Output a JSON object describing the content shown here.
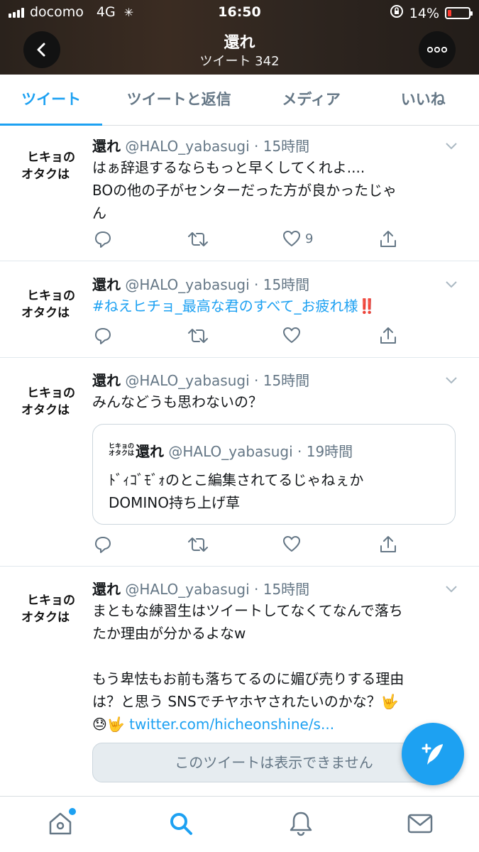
{
  "status_bar": {
    "carrier": "docomo",
    "network": "4G",
    "time": "16:50",
    "battery": "14%"
  },
  "header": {
    "title": "還れ",
    "subtitle": "ツイート 342"
  },
  "tabs": [
    {
      "label": "ツイート",
      "active": true
    },
    {
      "label": "ツイートと返信",
      "active": false
    },
    {
      "label": "メディア",
      "active": false
    },
    {
      "label": "いいね",
      "active": false
    }
  ],
  "tweets": [
    {
      "avatar_l1": "ヒキョの",
      "avatar_l2": "オタクは",
      "name": "還れ",
      "meta": " @HALO_yabasugi · 15時間",
      "text_l1": "はぁ辞退するならもっと早くしてくれよ....",
      "text_l2": "BOの他の子がセンターだった方が良かったじゃ",
      "text_l3": "ん",
      "like_count": "9"
    },
    {
      "avatar_l1": "ヒキョの",
      "avatar_l2": "オタクは",
      "name": "還れ",
      "meta": " @HALO_yabasugi · 15時間",
      "hashtag": "#ねえヒチョ_最高な君のすべて_お疲れ様",
      "emoji": "‼️"
    },
    {
      "avatar_l1": "ヒキョの",
      "avatar_l2": "オタクは",
      "name": "還れ",
      "meta": " @HALO_yabasugi · 15時間",
      "text_l1": "みんなどうも思わないの？",
      "quote": {
        "avatar_l1": "ヒキョの",
        "avatar_l2": "オタクは",
        "name": "還れ",
        "meta": " @HALO_yabasugi · 19時間",
        "text_l1": "ﾄﾞｨｺﾞﾓﾞｫのとこ編集されてるじゃねぇか",
        "text_l2": "DOMINO持ち上げ草"
      }
    },
    {
      "avatar_l1": "ヒキョの",
      "avatar_l2": "オタクは",
      "name": "還れ",
      "meta": " @HALO_yabasugi · 15時間",
      "text_l1": "まともな練習生はツイートしてなくてなんで落ち",
      "text_l2": "たか理由が分かるよなw",
      "text_l3": "もう卑怯もお前も落ちてるのに媚び売りする理由",
      "text_l4": "は？と思う SNSでチヤホヤされたいのかな？🤟",
      "text_l5_emoji": "😓🤟",
      "link": "twitter.com/hicheonshine/s...",
      "unavailable": "このツイートは表示できません"
    }
  ],
  "colors": {
    "accent": "#1da1f2",
    "secondary_text": "#657786"
  }
}
